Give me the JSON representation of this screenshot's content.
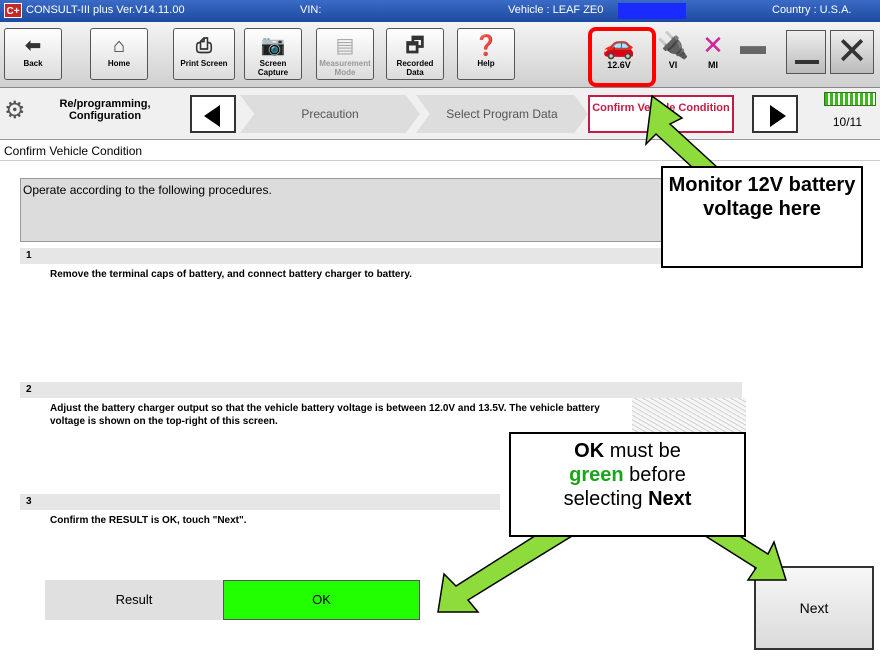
{
  "titlebar": {
    "logo": "C+",
    "app_title": "CONSULT-III plus  Ver.V14.11.00",
    "vin_label": "VIN:",
    "vehicle": "Vehicle : LEAF ZE0",
    "country": "Country : U.S.A."
  },
  "toolbar": {
    "back": "Back",
    "home": "Home",
    "print": "Print Screen",
    "capture": "Screen Capture",
    "measurement": "Measurement Mode",
    "recorded": "Recorded Data",
    "help": "Help",
    "status_voltage": "12.6V",
    "status_vi": "VI",
    "status_mi": "MI"
  },
  "stepbar": {
    "mode": "Re/programming, Configuration",
    "step1": "Precaution",
    "step2": "Select Program Data",
    "step3": "Confirm Vehicle Condition",
    "progress": "10/11"
  },
  "page": {
    "title": "Confirm Vehicle Condition",
    "instructions": "Operate according to the following procedures.",
    "steps": [
      {
        "num": "1",
        "text": "Remove the terminal caps of battery, and connect battery charger to battery."
      },
      {
        "num": "2",
        "text": "Adjust the battery charger output so that the vehicle battery voltage is between 12.0V and 13.5V. The vehicle battery voltage is shown on the top-right of this screen."
      },
      {
        "num": "3",
        "text": "Confirm the RESULT is OK, touch \"Next\"."
      }
    ],
    "result_label": "Result",
    "result_value": "OK",
    "next": "Next"
  },
  "callouts": {
    "monitor": "Monitor 12V battery voltage here",
    "ok_line1_bold": "OK",
    "ok_line1_rest": " must be",
    "ok_line2_green": "green",
    "ok_line2_rest": " before",
    "ok_line3_pre": "selecting ",
    "ok_line3_bold": "Next"
  },
  "colors": {
    "ok_green": "#22ff00",
    "callout_arrow": "#8edc3c",
    "highlight": "#ff0000",
    "current_step": "#c21b44"
  }
}
